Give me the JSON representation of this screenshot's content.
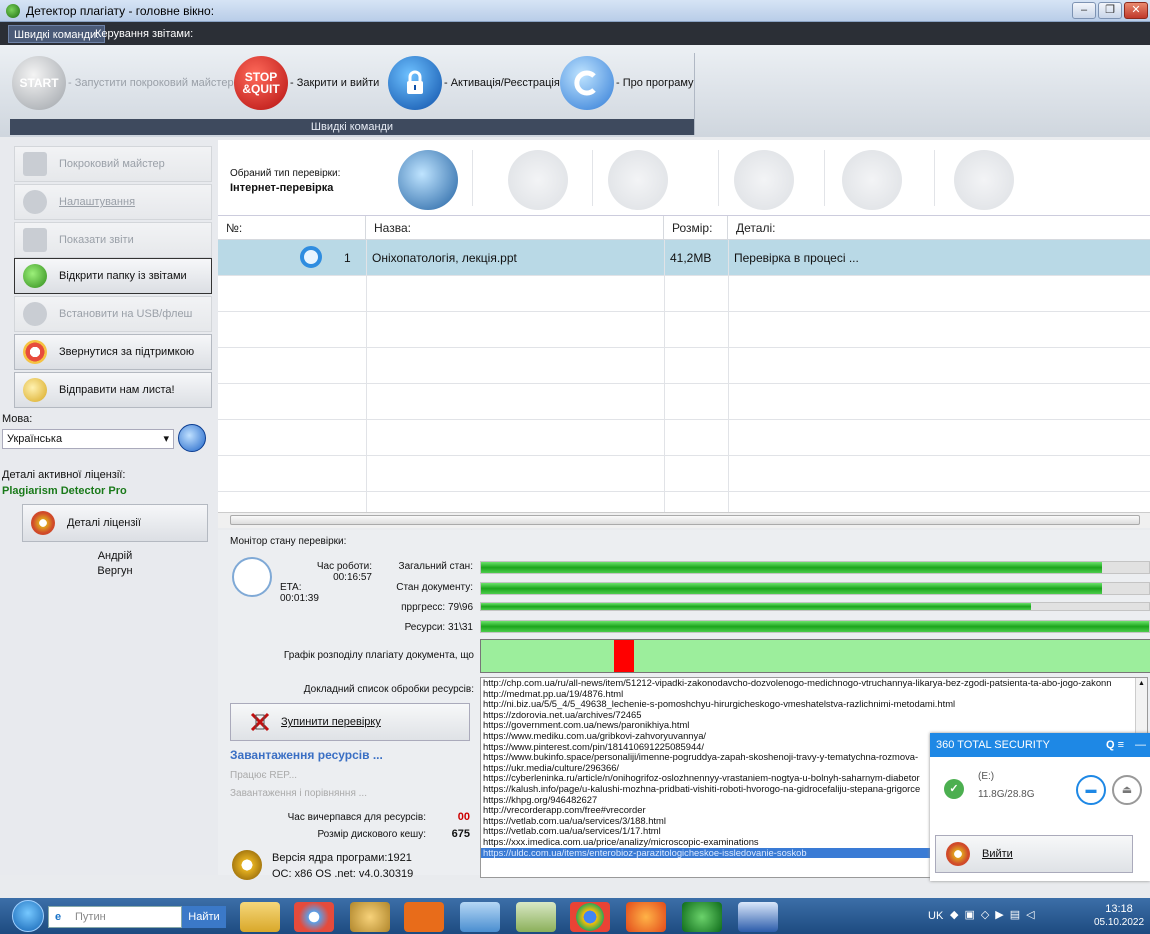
{
  "window": {
    "title": "Детектор плагіату - головне вікно:"
  },
  "menu": {
    "tabs": [
      "Швидкі команди:",
      "Керування звітами:"
    ]
  },
  "ribbon": {
    "buttons": [
      {
        "icon": "START",
        "label": "- Запустити покроковий майстер",
        "disabled": true
      },
      {
        "icon": "STOP &QUIT",
        "label": "- Закрити и вийти"
      },
      {
        "icon": "lock-icon",
        "label": "- Активація/Реєстрація"
      },
      {
        "icon": "about-icon",
        "label": "- Про програму"
      }
    ],
    "caption": "Швидкі команди"
  },
  "sidebar": {
    "buttons": [
      {
        "label": "Покроковий майстер",
        "disabled": true,
        "color": "#c9cdd3"
      },
      {
        "label": "Налаштування",
        "disabled": true,
        "color": "#c9cdd3"
      },
      {
        "label": "Показати звіти",
        "disabled": true,
        "color": "#c9cdd3"
      },
      {
        "label": "Відкрити папку із звітами",
        "disabled": false,
        "color": "#3fae2a"
      },
      {
        "label": "Встановити на USB/флеш",
        "disabled": true,
        "color": "#c9cdd3"
      },
      {
        "label": "Звернутися за підтримкою",
        "disabled": false,
        "color": "#e0b420"
      },
      {
        "label": "Відправити нам листа!",
        "disabled": false,
        "color": "#e6c34a"
      }
    ],
    "language_label": "Мова:",
    "language_value": "Українська",
    "license_label": "Деталі активної ліцензії:",
    "license_name": "Plagiarism Detector Pro",
    "license_button": "Деталі ліцензії",
    "user_first": "Андрій",
    "user_last": "Вергун"
  },
  "check": {
    "type_label": "Обраний тип перевірки:",
    "type_value": "Інтернет-перевірка"
  },
  "table": {
    "headers": [
      "№:",
      "Назва:",
      "Розмір:",
      "Деталі:"
    ],
    "rows": [
      {
        "num": "1",
        "name": "Оніхопатологія, лекція.ppt",
        "size": "41,2MB",
        "details": "Перевірка в процесі ..."
      }
    ]
  },
  "monitor": {
    "title": "Монітор стану перевірки:",
    "runtime": "Час роботи: 00:16:57",
    "eta": "ETA: 00:01:39",
    "overall_label": "Загальний стан:",
    "doc_label": "Стан документу:",
    "progress_label": "прргресс: 79\\96",
    "resources_label": "Ресурси: 31\\31",
    "overall_progress": 0.93,
    "doc_progress": 0.93,
    "progress_progress": 0.823,
    "resources_progress": 1.0,
    "chart_label": "Графік розподілу плагіату документа, що",
    "chart_marker_position": 0.1,
    "chart_marker_color": "#ff0000",
    "reslist_label": "Докладний список обробки ресурсів:",
    "stop_button": "Зупинити перевірку",
    "loading_title": "Завантаження ресурсів ...",
    "working": "Працює REP...",
    "loading_compare": "Завантаження і порівняння ...",
    "timeout_label": "Час вичерпався для ресурсів:",
    "timeout_value": "00",
    "cache_label": "Розмір дискового кешу:",
    "cache_value": "675",
    "core_version": "Версія ядра програми:1921",
    "os_info": "ОС: x86 OS .net: v4.0.30319",
    "resources": [
      "http://chp.com.ua/ru/all-news/item/51212-vipadki-zakonodavcho-dozvolenogo-medichnogo-vtruchannya-likarya-bez-zgodi-patsienta-ta-abo-jogo-zakonn",
      "http://medmat.pp.ua/19/4876.html",
      "http://ni.biz.ua/5/5_4/5_49638_lechenie-s-pomoshchyu-hirurgicheskogo-vmeshatelstva-razlichnimi-metodami.html",
      "https://zdorovia.net.ua/archives/72465",
      "https://government.com.ua/news/paronikhiya.html",
      "https://www.mediku.com.ua/gribkovi-zahvoryuvannya/",
      "https://www.pinterest.com/pin/181410691225085944/",
      "https://www.bukinfo.space/personaliji/imenne-pogruddya-zapah-skoshenoji-travy-y-tematychna-rozmova-",
      "https://ukr.media/culture/296366/",
      "https://cyberleninka.ru/article/n/onihogrifoz-oslozhnennyy-vrastaniem-nogtya-u-bolnyh-saharnym-diabetor",
      "https://kalush.info/page/u-kalushi-mozhna-pridbati-vishiti-roboti-hvorogo-na-gidrocefaliju-stepana-grigorce",
      "https://khpg.org/946482627",
      "http://vrecorderapp.com/free#vrecorder",
      "https://vetlab.com.ua/ua/services/3/188.html",
      "https://vetlab.com.ua/ua/services/1/17.html",
      "https://xxx.imedica.com.ua/price/analizy/microscopic-examinations",
      "https://uldc.com.ua/items/enterobioz-parazitologicheskoe-issledovanie-soskob"
    ]
  },
  "security360": {
    "title": "360 TOTAL SECURITY",
    "drive": "(E:)",
    "usage": "11.8G/28.8G",
    "exit": "Вийти"
  },
  "taskbar": {
    "search_placeholder": "Путин",
    "find": "Найти",
    "lang": "UK",
    "time": "13:18",
    "date": "05.10.2022"
  },
  "colors": {
    "accent": "#1e88e5",
    "selected_row": "#b9d9e6",
    "progress": "#1ca51c"
  }
}
